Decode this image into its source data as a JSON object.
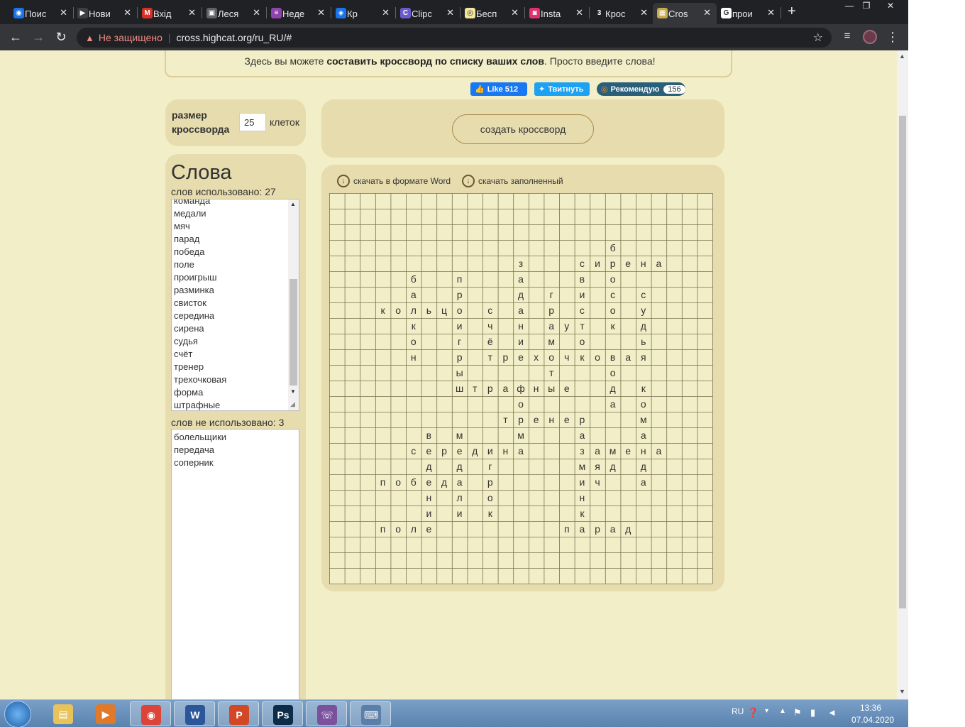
{
  "browser": {
    "tabs": [
      {
        "label": "Поис",
        "icon_color": "#1a73e8",
        "icon_char": "◉"
      },
      {
        "label": "Нови",
        "icon_color": "#3c4043",
        "icon_char": "▶"
      },
      {
        "label": "Вхід",
        "icon_color": "#d93025",
        "icon_char": "M"
      },
      {
        "label": "Леся",
        "icon_color": "#5f6368",
        "icon_char": "▣"
      },
      {
        "label": "Неде",
        "icon_color": "#8e44ad",
        "icon_char": "≡"
      },
      {
        "label": "Кр",
        "icon_color": "#1a73e8",
        "icon_char": "◈"
      },
      {
        "label": "Clipc",
        "icon_color": "#6a5acd",
        "icon_char": "C"
      },
      {
        "label": "Бесп",
        "icon_color": "#f2e69a",
        "icon_char": "◎"
      },
      {
        "label": "Insta",
        "icon_color": "#e1306c",
        "icon_char": "◙"
      },
      {
        "label": "Крос",
        "icon_color": "#202124",
        "icon_char": "3"
      },
      {
        "label": "Cros",
        "icon_color": "#c9a94a",
        "icon_char": "▦",
        "active": true
      },
      {
        "label": "прои",
        "icon_color": "#ffffff",
        "icon_char": "G"
      }
    ],
    "new_tab": "+",
    "window_controls": [
      "—",
      "❐",
      "✕"
    ],
    "security_label": "Не защищено",
    "url": "cross.highcat.org/ru_RU/#"
  },
  "page": {
    "intro_before": "Здесь вы можете ",
    "intro_bold": "составить кроссворд по списку ваших слов",
    "intro_after": ". Просто введите слова!",
    "social": {
      "fb_label": "Like 512",
      "tw_label": "Твитнуть",
      "ok_label": "Рекомендую",
      "ok_count": "156"
    },
    "size_label": "размер кроссворда",
    "size_value": "25",
    "size_unit": "клеток",
    "create_button": "создать кроссворд",
    "words_title": "Слова",
    "used_label": "слов использовано: 27",
    "used_words": [
      "команда",
      "медали",
      "мяч",
      "парад",
      "победа",
      "поле",
      "проигрыш",
      "разминка",
      "свисток",
      "середина",
      "сирена",
      "судья",
      "счёт",
      "тренер",
      "трехочковая",
      "форма",
      "штрафные"
    ],
    "unused_label": "слов не использовано: 3",
    "unused_words": [
      "болельщики",
      "передача",
      "соперник"
    ],
    "download_word": "скачать в формате Word",
    "download_filled": "скачать заполненный"
  },
  "grid": {
    "cols": 25,
    "rows": 25,
    "letters": [
      [
        3,
        18,
        "б"
      ],
      [
        4,
        12,
        "з"
      ],
      [
        4,
        16,
        "с"
      ],
      [
        4,
        17,
        "и"
      ],
      [
        4,
        18,
        "р"
      ],
      [
        4,
        19,
        "е"
      ],
      [
        4,
        20,
        "н"
      ],
      [
        4,
        21,
        "а"
      ],
      [
        5,
        5,
        "б"
      ],
      [
        5,
        8,
        "п"
      ],
      [
        5,
        12,
        "а"
      ],
      [
        5,
        16,
        "в"
      ],
      [
        5,
        18,
        "о"
      ],
      [
        6,
        5,
        "а"
      ],
      [
        6,
        8,
        "р"
      ],
      [
        6,
        12,
        "д"
      ],
      [
        6,
        14,
        "г"
      ],
      [
        6,
        16,
        "и"
      ],
      [
        6,
        18,
        "с"
      ],
      [
        6,
        20,
        "с"
      ],
      [
        7,
        3,
        "к"
      ],
      [
        7,
        4,
        "о"
      ],
      [
        7,
        5,
        "л"
      ],
      [
        7,
        6,
        "ь"
      ],
      [
        7,
        7,
        "ц"
      ],
      [
        7,
        8,
        "о"
      ],
      [
        7,
        10,
        "с"
      ],
      [
        7,
        12,
        "а"
      ],
      [
        7,
        14,
        "р"
      ],
      [
        7,
        16,
        "с"
      ],
      [
        7,
        18,
        "о"
      ],
      [
        7,
        20,
        "у"
      ],
      [
        8,
        5,
        "к"
      ],
      [
        8,
        8,
        "и"
      ],
      [
        8,
        10,
        "ч"
      ],
      [
        8,
        12,
        "н"
      ],
      [
        8,
        14,
        "а"
      ],
      [
        8,
        15,
        "у"
      ],
      [
        8,
        16,
        "т"
      ],
      [
        8,
        18,
        "к"
      ],
      [
        8,
        20,
        "д"
      ],
      [
        9,
        5,
        "о"
      ],
      [
        9,
        8,
        "г"
      ],
      [
        9,
        10,
        "ё"
      ],
      [
        9,
        12,
        "и"
      ],
      [
        9,
        14,
        "м"
      ],
      [
        9,
        16,
        "о"
      ],
      [
        9,
        20,
        "ь"
      ],
      [
        10,
        5,
        "н"
      ],
      [
        10,
        8,
        "р"
      ],
      [
        10,
        10,
        "т"
      ],
      [
        10,
        11,
        "р"
      ],
      [
        10,
        12,
        "е"
      ],
      [
        10,
        13,
        "х"
      ],
      [
        10,
        14,
        "о"
      ],
      [
        10,
        15,
        "ч"
      ],
      [
        10,
        16,
        "к"
      ],
      [
        10,
        17,
        "о"
      ],
      [
        10,
        18,
        "в"
      ],
      [
        10,
        19,
        "а"
      ],
      [
        10,
        20,
        "я"
      ],
      [
        11,
        8,
        "ы"
      ],
      [
        11,
        14,
        "т"
      ],
      [
        11,
        18,
        "о"
      ],
      [
        12,
        8,
        "ш"
      ],
      [
        12,
        9,
        "т"
      ],
      [
        12,
        10,
        "р"
      ],
      [
        12,
        11,
        "а"
      ],
      [
        12,
        12,
        "ф"
      ],
      [
        12,
        13,
        "н"
      ],
      [
        12,
        14,
        "ы"
      ],
      [
        12,
        15,
        "е"
      ],
      [
        12,
        18,
        "д"
      ],
      [
        12,
        20,
        "к"
      ],
      [
        13,
        12,
        "о"
      ],
      [
        13,
        18,
        "а"
      ],
      [
        13,
        20,
        "о"
      ],
      [
        14,
        11,
        "т"
      ],
      [
        14,
        12,
        "р"
      ],
      [
        14,
        13,
        "е"
      ],
      [
        14,
        14,
        "н"
      ],
      [
        14,
        15,
        "е"
      ],
      [
        14,
        16,
        "р"
      ],
      [
        14,
        20,
        "м"
      ],
      [
        15,
        6,
        "в"
      ],
      [
        15,
        8,
        "м"
      ],
      [
        15,
        12,
        "м"
      ],
      [
        15,
        16,
        "а"
      ],
      [
        15,
        20,
        "а"
      ],
      [
        16,
        5,
        "с"
      ],
      [
        16,
        6,
        "е"
      ],
      [
        16,
        7,
        "р"
      ],
      [
        16,
        8,
        "е"
      ],
      [
        16,
        9,
        "д"
      ],
      [
        16,
        10,
        "и"
      ],
      [
        16,
        11,
        "н"
      ],
      [
        16,
        12,
        "а"
      ],
      [
        16,
        16,
        "з"
      ],
      [
        16,
        17,
        "а"
      ],
      [
        16,
        18,
        "м"
      ],
      [
        16,
        19,
        "е"
      ],
      [
        16,
        20,
        "н"
      ],
      [
        16,
        21,
        "а"
      ],
      [
        17,
        6,
        "д"
      ],
      [
        17,
        8,
        "д"
      ],
      [
        17,
        10,
        "г"
      ],
      [
        17,
        16,
        "м"
      ],
      [
        17,
        17,
        "я"
      ],
      [
        17,
        18,
        "д"
      ],
      [
        17,
        20,
        "д"
      ],
      [
        18,
        3,
        "п"
      ],
      [
        18,
        4,
        "о"
      ],
      [
        18,
        5,
        "б"
      ],
      [
        18,
        6,
        "е"
      ],
      [
        18,
        7,
        "д"
      ],
      [
        18,
        8,
        "а"
      ],
      [
        18,
        10,
        "р"
      ],
      [
        18,
        16,
        "и"
      ],
      [
        18,
        17,
        "ч"
      ],
      [
        18,
        20,
        "а"
      ],
      [
        19,
        6,
        "н"
      ],
      [
        19,
        8,
        "л"
      ],
      [
        19,
        10,
        "о"
      ],
      [
        19,
        16,
        "н"
      ],
      [
        20,
        6,
        "и"
      ],
      [
        20,
        8,
        "и"
      ],
      [
        20,
        10,
        "к"
      ],
      [
        20,
        16,
        "к"
      ],
      [
        21,
        3,
        "п"
      ],
      [
        21,
        4,
        "о"
      ],
      [
        21,
        5,
        "л"
      ],
      [
        21,
        6,
        "е"
      ],
      [
        21,
        15,
        "п"
      ],
      [
        21,
        16,
        "а"
      ],
      [
        21,
        17,
        "р"
      ],
      [
        21,
        18,
        "а"
      ],
      [
        21,
        19,
        "д"
      ]
    ]
  },
  "taskbar": {
    "apps": [
      {
        "name": "explorer",
        "color": "#e8c25a",
        "char": "▤"
      },
      {
        "name": "media",
        "color": "#e07a2a",
        "char": "▶"
      },
      {
        "name": "chrome",
        "color": "#db4437",
        "char": "◉",
        "open": true
      },
      {
        "name": "word",
        "color": "#2b579a",
        "char": "W",
        "open": true
      },
      {
        "name": "powerpoint",
        "color": "#d24726",
        "char": "P",
        "open": true
      },
      {
        "name": "photoshop",
        "color": "#0d2c4a",
        "char": "Ps",
        "open": true
      },
      {
        "name": "viber",
        "color": "#7b519d",
        "char": "☏",
        "open": true
      },
      {
        "name": "keyboard",
        "color": "#5b7fa8",
        "char": "⌨",
        "open": true
      }
    ],
    "lang": "RU",
    "time": "13:36",
    "date": "07.04.2020"
  }
}
